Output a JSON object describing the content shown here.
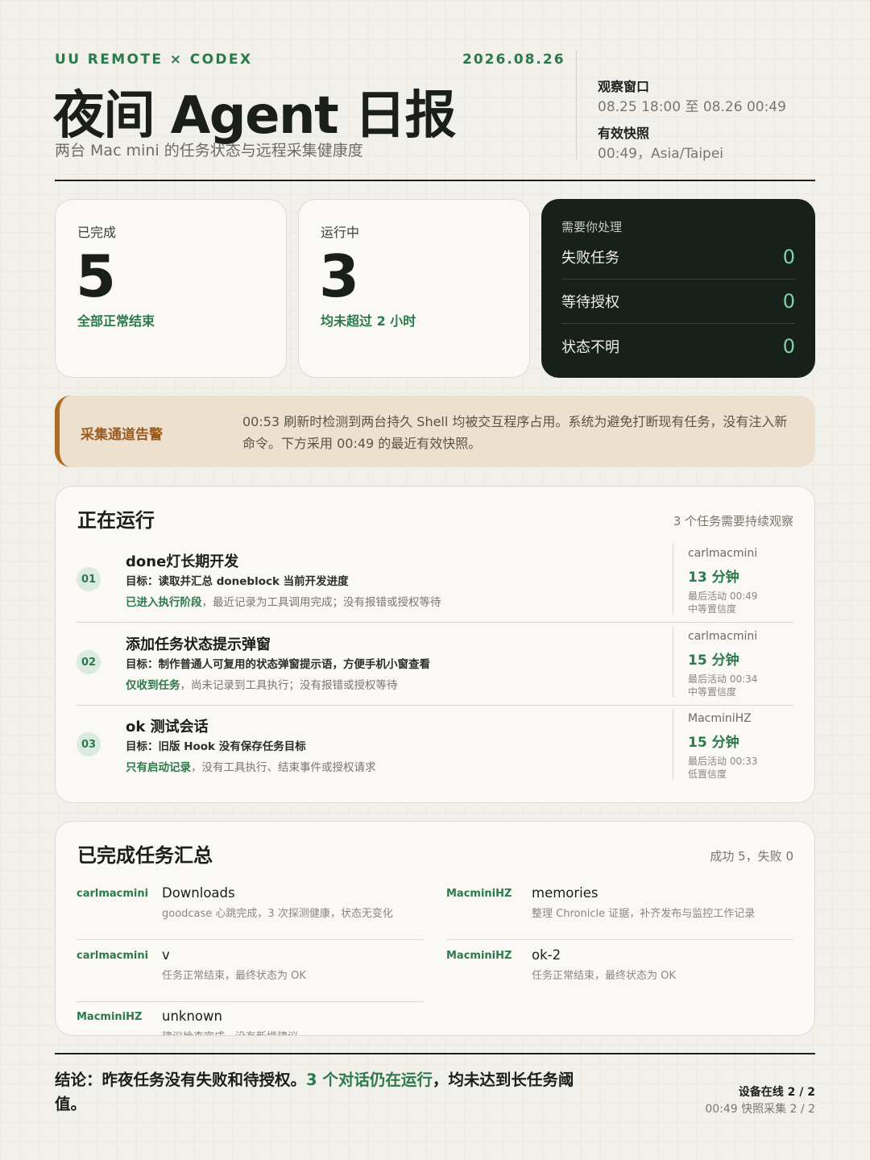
{
  "header": {
    "brand": "UU REMOTE × CODEX",
    "date": "2026.08.26",
    "title": "夜间 Agent 日报",
    "subtitle": "两台 Mac mini 的任务状态与远程采集健康度",
    "window_label": "观察窗口",
    "window_value": "08.25 18:00 至 08.26 00:49",
    "snapshot_label": "有效快照",
    "snapshot_value": "00:49，Asia/Taipei"
  },
  "stats": {
    "completed": {
      "label": "已完成",
      "value": "5",
      "note": "全部正常结束"
    },
    "running": {
      "label": "运行中",
      "value": "3",
      "note": "均未超过 2 小时"
    }
  },
  "attention": {
    "title": "需要你处理",
    "rows": [
      {
        "label": "失败任务",
        "value": "0"
      },
      {
        "label": "等待授权",
        "value": "0"
      },
      {
        "label": "状态不明",
        "value": "0"
      }
    ]
  },
  "warning": {
    "title": "采集通道告警",
    "text": "00:53 刷新时检测到两台持久 Shell 均被交互程序占用。系统为避免打断现有任务，没有注入新命令。下方采用 00:49 的最近有效快照。"
  },
  "running": {
    "title": "正在运行",
    "meta": "3 个任务需要持续观察",
    "tasks": [
      {
        "num": "01",
        "name": "done灯长期开发",
        "goal": "目标：读取并汇总 doneblock 当前开发进度",
        "status_hl": "已进入执行阶段",
        "status_rest": "，最近记录为工具调用完成；没有报错或授权等待",
        "host": "carlmacmini",
        "duration": "13 分钟",
        "last": "最后活动 00:49",
        "confidence": "中等置信度"
      },
      {
        "num": "02",
        "name": "添加任务状态提示弹窗",
        "goal": "目标：制作普通人可复用的状态弹窗提示语，方便手机小窗查看",
        "status_hl": "仅收到任务",
        "status_rest": "，尚未记录到工具执行；没有报错或授权等待",
        "host": "carlmacmini",
        "duration": "15 分钟",
        "last": "最后活动 00:34",
        "confidence": "中等置信度"
      },
      {
        "num": "03",
        "name": "ok 测试会话",
        "goal": "目标：旧版 Hook 没有保存任务目标",
        "status_hl": "只有启动记录",
        "status_rest": "，没有工具执行、结束事件或授权请求",
        "host": "MacminiHZ",
        "duration": "15 分钟",
        "last": "最后活动 00:33",
        "confidence": "低置信度"
      }
    ]
  },
  "completed": {
    "title": "已完成任务汇总",
    "meta": "成功 5，失败 0",
    "items": [
      {
        "host": "carlmacmini",
        "name": "Downloads",
        "desc": "goodcase 心跳完成，3 次探测健康，状态无变化"
      },
      {
        "host": "MacminiHZ",
        "name": "memories",
        "desc": "整理 Chronicle 证据，补齐发布与监控工作记录"
      },
      {
        "host": "carlmacmini",
        "name": "v",
        "desc": "任务正常结束，最终状态为 OK"
      },
      {
        "host": "MacminiHZ",
        "name": "ok-2",
        "desc": "任务正常结束，最终状态为 OK"
      },
      {
        "host": "MacminiHZ",
        "name": "unknown",
        "desc": "建议检查完成，没有新增建议"
      }
    ]
  },
  "footer": {
    "conclusion_a": "结论：昨夜任务没有失败和待授权。",
    "conclusion_hl": "3 个对话仍在运行",
    "conclusion_b": "，均未达到长任务阈值。",
    "online": "设备在线 2 / 2",
    "snapshot": "00:49 快照采集 2 / 2"
  }
}
